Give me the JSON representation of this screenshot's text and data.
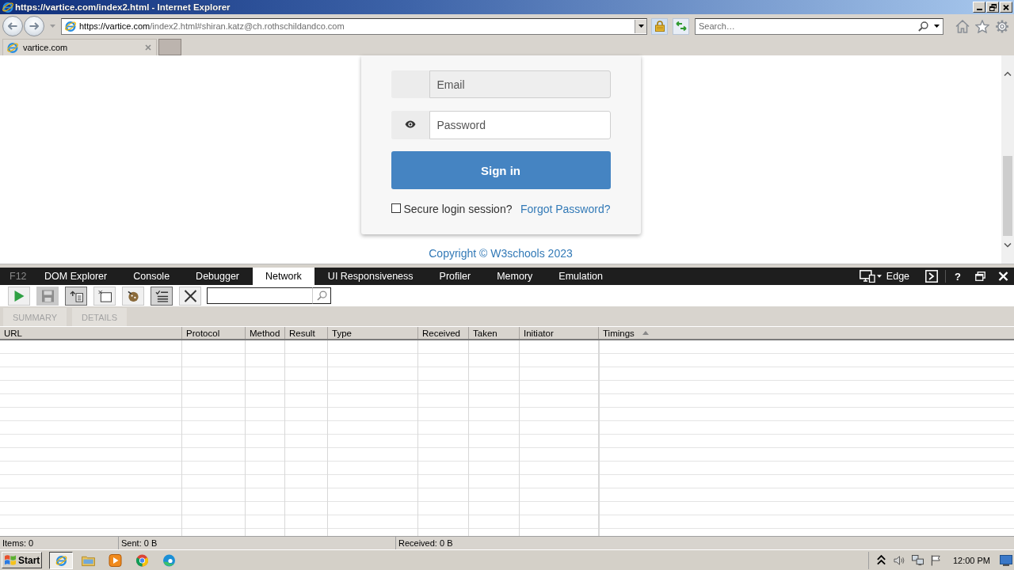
{
  "window": {
    "title": "https://vartice.com/index2.html - Internet Explorer"
  },
  "address_bar": {
    "url_domain": "https://vartice.com",
    "url_path": "/index2.html#shiran.katz@ch.rothschildandco.com"
  },
  "search": {
    "placeholder": "Search…"
  },
  "tabs": [
    {
      "label": "vartice.com",
      "selected": true
    }
  ],
  "login": {
    "email": {
      "placeholder": "Email",
      "disabled": true
    },
    "password": {
      "placeholder": "Password"
    },
    "submit": "Sign in",
    "remember": {
      "label": "Secure login session?",
      "checked": false
    },
    "forgot_link": "Forgot Password?"
  },
  "footer": {
    "copyright": "Copyright © W3schools 2023"
  },
  "devtools": {
    "f12": "F12",
    "tabs": [
      {
        "label": "DOM Explorer",
        "selected": false
      },
      {
        "label": "Console",
        "selected": false
      },
      {
        "label": "Debugger",
        "selected": false
      },
      {
        "label": "Network",
        "selected": true
      },
      {
        "label": "UI Responsiveness",
        "selected": false
      },
      {
        "label": "Profiler",
        "selected": false
      },
      {
        "label": "Memory",
        "selected": false
      },
      {
        "label": "Emulation",
        "selected": false
      }
    ],
    "emulation": "Edge",
    "help": "?",
    "toolbar": [
      {
        "kind": "play",
        "pressed": false,
        "disabled": false
      },
      {
        "kind": "save",
        "pressed": false,
        "disabled": true
      },
      {
        "kind": "server",
        "pressed": true,
        "disabled": false
      },
      {
        "kind": "cache",
        "pressed": false,
        "disabled": false
      },
      {
        "kind": "cookies",
        "pressed": false,
        "disabled": false
      },
      {
        "kind": "list",
        "pressed": true,
        "disabled": false
      },
      {
        "kind": "clear",
        "pressed": false,
        "disabled": false
      }
    ],
    "views": [
      {
        "label": "SUMMARY",
        "disabled": true
      },
      {
        "label": "DETAILS",
        "disabled": true
      }
    ],
    "columns": [
      {
        "label": "URL",
        "sorted": false
      },
      {
        "label": "Protocol",
        "sorted": false
      },
      {
        "label": "Method",
        "sorted": false
      },
      {
        "label": "Result",
        "sorted": false
      },
      {
        "label": "Type",
        "sorted": false
      },
      {
        "label": "Received",
        "sorted": false
      },
      {
        "label": "Taken",
        "sorted": false
      },
      {
        "label": "Initiator",
        "sorted": false
      },
      {
        "label": "Timings",
        "sorted": true
      }
    ]
  },
  "status_bar": [
    "Items: 0",
    "Sent: 0 B",
    "Received: 0 B"
  ],
  "taskbar": {
    "start": "Start",
    "apps": [
      {
        "kind": "browser",
        "active": true
      },
      {
        "kind": "folder",
        "active": false
      },
      {
        "kind": "media",
        "active": false
      },
      {
        "kind": "chrome",
        "active": false
      },
      {
        "kind": "edge",
        "active": false
      }
    ],
    "clock": "12:00 PM"
  }
}
